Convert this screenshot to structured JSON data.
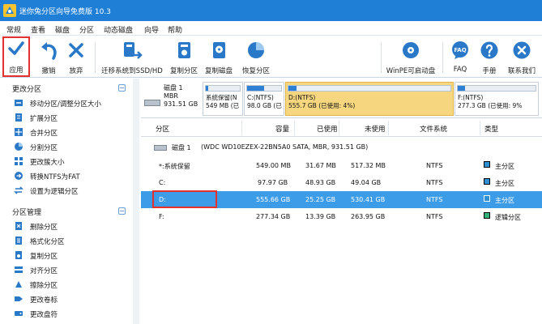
{
  "window": {
    "title": "迷你兔分区向导免费版 10.3"
  },
  "menu": [
    "常规",
    "查看",
    "磁盘",
    "分区",
    "动态磁盘",
    "向导",
    "帮助"
  ],
  "toolbar": {
    "apply": "应用",
    "undo": "撤销",
    "discard": "放弃",
    "migrate": "迁移系统到SSD/HD",
    "copy_partition": "复制分区",
    "copy_disk": "复制磁盘",
    "recovery": "恢复分区",
    "winpe": "WinPE可启动盘",
    "faq": "FAQ",
    "manual": "手册",
    "contact": "联系我们",
    "faq_badge": "FAQ"
  },
  "sidebar": {
    "section1": "更改分区",
    "section1_items": [
      "移动分区/调整分区大小",
      "扩展分区",
      "合并分区",
      "分割分区",
      "更改簇大小",
      "转换NTFS为FAT",
      "设置为逻辑分区"
    ],
    "section2": "分区管理",
    "section2_items": [
      "删除分区",
      "格式化分区",
      "复制分区",
      "对齐分区",
      "擦除分区",
      "更改卷标",
      "更改盘符"
    ],
    "collapse_symbol": "−"
  },
  "diskmap": {
    "disk_name": "磁盘 1",
    "disk_type": "MBR",
    "disk_size": "931.51 GB",
    "partitions": [
      {
        "line1": "系统保留(N",
        "line2": "549 MB (已",
        "fill": 0.06
      },
      {
        "line1": "C:(NTFS)",
        "line2": "98.0 GB (已",
        "fill": 0.5
      },
      {
        "line1": "D:(NTFS)",
        "line2": "555.7 GB (已使用: 4%)",
        "fill": 0.05
      },
      {
        "line1": "F:(NTFS)",
        "line2": "277.3 GB (已使用: 9%",
        "fill": 0.09
      }
    ]
  },
  "table": {
    "headers": [
      "分区",
      "容量",
      "已使用",
      "未使用",
      "文件系统",
      "类型"
    ],
    "disk_row": {
      "label": "磁盘 1",
      "detail": "(WDC WD10EZEX-22BN5A0 SATA, MBR, 931.51 GB)"
    },
    "rows": [
      {
        "name": "*:系统保留",
        "capacity": "549.00 MB",
        "used": "31.67 MB",
        "free": "517.32 MB",
        "fs": "NTFS",
        "type": "主分区"
      },
      {
        "name": "C:",
        "capacity": "97.97 GB",
        "used": "48.93 GB",
        "free": "49.04 GB",
        "fs": "NTFS",
        "type": "主分区"
      },
      {
        "name": "D:",
        "capacity": "555.66 GB",
        "used": "25.25 GB",
        "free": "530.41 GB",
        "fs": "NTFS",
        "type": "主分区"
      },
      {
        "name": "F:",
        "capacity": "277.34 GB",
        "used": "13.39 GB",
        "free": "263.95 GB",
        "fs": "NTFS",
        "type": "逻辑分区"
      }
    ]
  },
  "colors": {
    "accent": "#1f7fd6",
    "selected_row": "#3d9ce8",
    "selected_partition": "#f6d780",
    "highlight_box": "#e53030"
  }
}
